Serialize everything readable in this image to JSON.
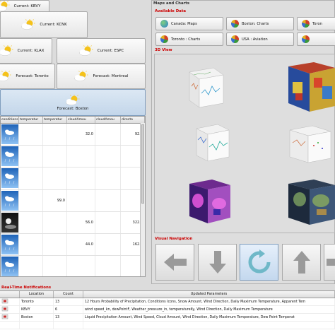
{
  "weather_tabs": [
    {
      "label": "Current: KBVY",
      "icon": "partly-cloudy-icon"
    },
    {
      "label": "Current: KCNK",
      "icon": "partly-cloudy-icon"
    },
    {
      "label": "Current: KLAX",
      "icon": "partly-cloudy-icon"
    },
    {
      "label": "Current: ESPC",
      "icon": "partly-cloudy-icon"
    },
    {
      "label": "Forecast: Toronto",
      "icon": "partly-cloudy-icon"
    },
    {
      "label": "Forecast: Montreal",
      "icon": "partly-cloudy-icon"
    },
    {
      "label": "Forecast: Boston",
      "icon": "partly-cloudy-icon",
      "selected": true
    }
  ],
  "forecast_table": {
    "columns": [
      "conditions",
      "temperatur",
      "temperatur",
      "cloudAmou",
      "cloudAmou",
      "directo"
    ],
    "rows": [
      {
        "icon": "day-weather-icon",
        "cells": [
          "",
          "",
          "32.0",
          "",
          "92.0"
        ]
      },
      {
        "icon": "day-weather-icon",
        "cells": [
          "",
          "",
          "",
          "",
          ""
        ]
      },
      {
        "icon": "day-weather-icon",
        "cells": [
          "",
          "",
          "",
          "",
          ""
        ]
      },
      {
        "icon": "day-weather-icon",
        "cells": [
          "",
          "99.0",
          "",
          "",
          ""
        ]
      },
      {
        "icon": "night-weather-icon",
        "cells": [
          "",
          "",
          "56.0",
          "",
          "322.0"
        ]
      },
      {
        "icon": "day-weather-icon",
        "cells": [
          "",
          "",
          "44.0",
          "",
          "162.0"
        ]
      },
      {
        "icon": "day-weather-icon",
        "cells": [
          "",
          "",
          "",
          "",
          ""
        ]
      }
    ]
  },
  "maps_and_charts": {
    "section_title": "Maps and Charts",
    "available_title": "Available Data",
    "data_buttons": [
      {
        "label": "Canada: Maps",
        "icon": "globe-icon"
      },
      {
        "label": "Boston: Charts",
        "icon": "chart-icon"
      },
      {
        "label": "Toron",
        "icon": "chart-icon"
      },
      {
        "label": "Toronto : Charts",
        "icon": "chart-icon"
      },
      {
        "label": "USA : Aviation",
        "icon": "chart-icon"
      },
      {
        "label": "",
        "icon": "chart-icon"
      }
    ],
    "view_title": "3D View",
    "nav_title": "Visual Navigation"
  },
  "notifications": {
    "title": "Real-Time Notifications",
    "columns": [
      "",
      "Location",
      "Count",
      "Updated Parameters"
    ],
    "rows": [
      {
        "location": "Toronto",
        "count": "13",
        "params": "12 Hours Probability of Precipitation, Conditions Icons, Snow Amount, Wind Direction, Daily Maximum Temperature, Apparent Tem"
      },
      {
        "location": "KBVY",
        "count": "6",
        "params": "wind speed_kn, dewPointF, Weather_pressure_in, temperatureKy, Wind Direction, Daily Maximum Temperature"
      },
      {
        "location": "Boston",
        "count": "13",
        "params": "Liquid Precipitation Amount, Wind Speed, Cloud Amount, Wind Direction, Daily Maximum Temperature, Dew Point Temperat"
      },
      {
        "location": "",
        "count": "",
        "params": ""
      }
    ]
  },
  "colors": {
    "section_title": "#cc0000",
    "selected_tab": "#c3d6ea"
  }
}
